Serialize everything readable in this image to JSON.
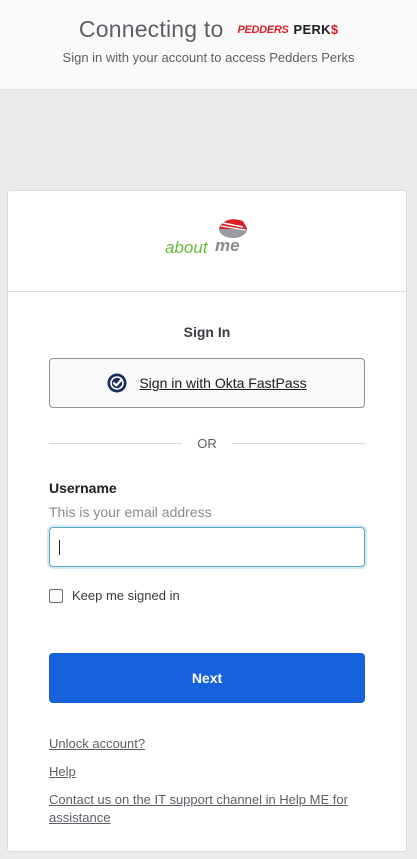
{
  "header": {
    "connecting_text": "Connecting to",
    "brand_part1": "PEDDERS",
    "brand_part2": "PERK",
    "brand_part3": "$",
    "subtitle": "Sign in with your account to access Pedders Perks"
  },
  "logo": {
    "text_about": "about",
    "text_me": "me"
  },
  "signin": {
    "title": "Sign In",
    "fastpass_label": "Sign in with Okta FastPass",
    "divider_text": "OR",
    "username_label": "Username",
    "username_hint": "This is your email address",
    "username_value": "",
    "keep_signed_in_label": "Keep me signed in",
    "keep_signed_in_checked": false,
    "next_label": "Next"
  },
  "links": {
    "unlock": "Unlock account?",
    "help": "Help",
    "contact": "Contact us on the IT support channel in Help ME for assistance"
  },
  "colors": {
    "primary_button": "#1662dd",
    "brand_red": "#d8202a",
    "logo_green": "#6aba3b",
    "fastpass_icon": "#1a2b5e"
  }
}
